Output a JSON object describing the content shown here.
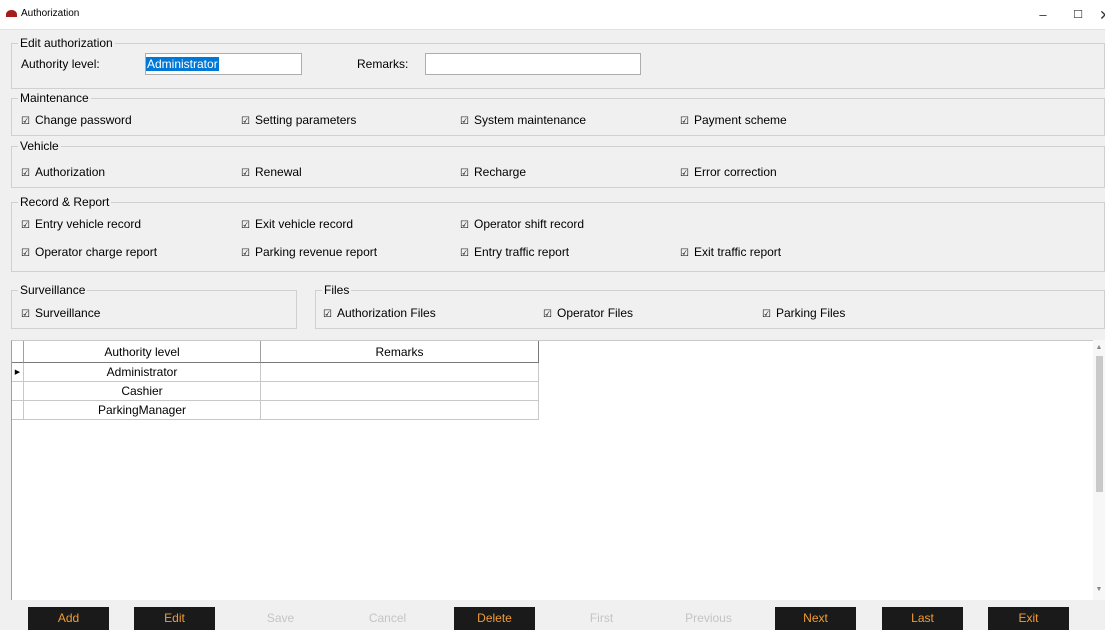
{
  "window": {
    "title": "Authorization",
    "controls": {
      "minimize": "–",
      "maximize": "☐",
      "close": "✕"
    },
    "icon": "car-icon",
    "icon_color": "#a61c1c"
  },
  "edit": {
    "legend": "Edit authorization",
    "authority_label": "Authority level:",
    "authority_value": "Administrator",
    "remarks_label": "Remarks:",
    "remarks_value": ""
  },
  "maintenance": {
    "legend": "Maintenance",
    "items": [
      "Change password",
      "Setting parameters",
      "System maintenance",
      "Payment scheme"
    ]
  },
  "vehicle": {
    "legend": "Vehicle",
    "items": [
      "Authorization",
      "Renewal",
      "Recharge",
      "Error correction"
    ]
  },
  "records": {
    "legend": "Record & Report",
    "items": [
      "Entry vehicle record",
      "Exit vehicle record",
      "Operator shift record",
      "Operator charge report",
      "Parking revenue report",
      "Entry traffic report",
      "Exit traffic report"
    ]
  },
  "surveillance": {
    "legend": "Surveillance",
    "items": [
      "Surveillance"
    ]
  },
  "files": {
    "legend": "Files",
    "items": [
      "Authorization Files",
      "Operator Files",
      "Parking Files"
    ]
  },
  "checkbox_glyph": "☑",
  "table": {
    "columns": [
      "Authority level",
      "Remarks"
    ],
    "rows": [
      {
        "level": "Administrator",
        "remarks": "",
        "current": true
      },
      {
        "level": "Cashier",
        "remarks": ""
      },
      {
        "level": "ParkingManager",
        "remarks": ""
      }
    ],
    "current_row_marker": "▶"
  },
  "buttons": [
    {
      "label": "Add",
      "enabled": true
    },
    {
      "label": "Edit",
      "enabled": true
    },
    {
      "label": "Save",
      "enabled": false
    },
    {
      "label": "Cancel",
      "enabled": false
    },
    {
      "label": "Delete",
      "enabled": true
    },
    {
      "label": "First",
      "enabled": false
    },
    {
      "label": "Previous",
      "enabled": false
    },
    {
      "label": "Next",
      "enabled": true
    },
    {
      "label": "Last",
      "enabled": true
    },
    {
      "label": "Exit",
      "enabled": true
    }
  ],
  "colors": {
    "accent_text": "#f39c33",
    "button_bg": "#1a1a1a",
    "disabled_text": "#c4c4c4",
    "selection": "#0078d7"
  }
}
